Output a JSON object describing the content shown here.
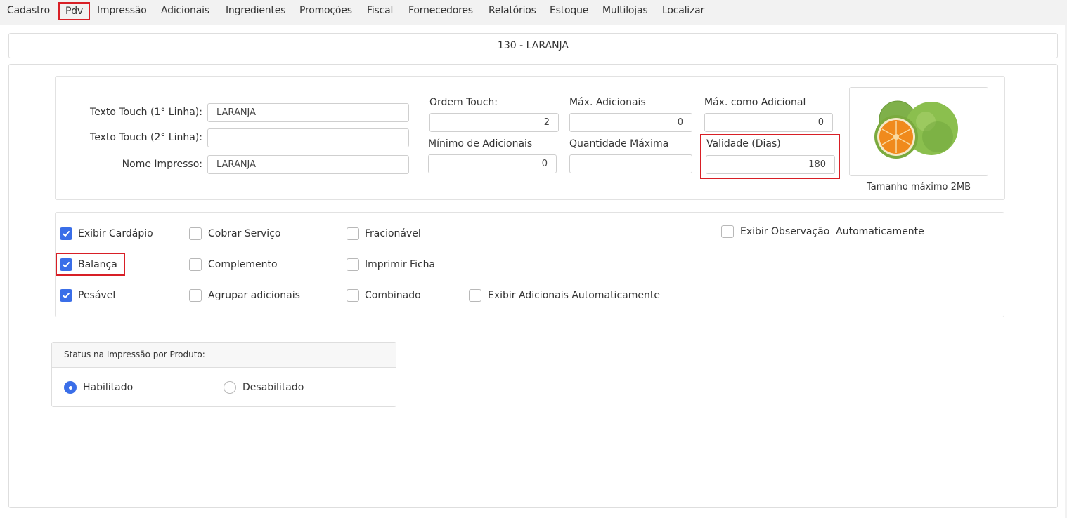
{
  "nav": {
    "tabs": [
      "Cadastro",
      "Pdv",
      "Impressão",
      "Adicionais",
      "Ingredientes",
      "Promoções",
      "Fiscal",
      "Fornecedores",
      "Relatórios",
      "Estoque",
      "Multilojas",
      "Localizar"
    ],
    "active": "Pdv"
  },
  "product": {
    "header": "130 - LARANJA"
  },
  "touch": {
    "line1_label": "Texto Touch (1° Linha):",
    "line1_value": "LARANJA",
    "line2_label": "Texto Touch (2° Linha):",
    "line2_value": "",
    "print_name_label": "Nome Impresso:",
    "print_name_value": "LARANJA"
  },
  "fields": {
    "ordem_touch_label": "Ordem Touch:",
    "ordem_touch_value": "2",
    "max_adicionais_label": "Máx. Adicionais",
    "max_adicionais_value": "0",
    "max_como_adicional_label": "Máx. como Adicional",
    "max_como_adicional_value": "0",
    "min_adicionais_label": "Mínimo de Adicionais",
    "min_adicionais_value": "0",
    "qtd_maxima_label": "Quantidade Máxima",
    "qtd_maxima_value": "",
    "validade_label": "Validade (Dias)",
    "validade_value": "180"
  },
  "image": {
    "caption": "Tamanho máximo 2MB",
    "icon": "orange-fruit-photo"
  },
  "options": {
    "exibir_cardapio": {
      "label": "Exibir Cardápio",
      "checked": true
    },
    "cobrar_servico": {
      "label": "Cobrar Serviço",
      "checked": false
    },
    "fracionavel": {
      "label": "Fracionável",
      "checked": false
    },
    "exibir_observacao": {
      "label": "Exibir Observação  Automaticamente",
      "checked": false
    },
    "balanca": {
      "label": "Balança",
      "checked": true
    },
    "complemento": {
      "label": "Complemento",
      "checked": false
    },
    "imprimir_ficha": {
      "label": "Imprimir Ficha",
      "checked": false
    },
    "pesavel": {
      "label": "Pesável",
      "checked": true
    },
    "agrupar_adicionais": {
      "label": "Agrupar adicionais",
      "checked": false
    },
    "combinado": {
      "label": "Combinado",
      "checked": false
    },
    "exibir_adicionais": {
      "label": "Exibir Adicionais Automaticamente",
      "checked": false
    }
  },
  "status": {
    "title": "Status na Impressão por Produto:",
    "habilitado_label": "Habilitado",
    "desabilitado_label": "Desabilitado",
    "selected": "Habilitado"
  },
  "colors": {
    "accent": "#3a6ee8",
    "highlight": "#d81f26",
    "nav_bg": "#f2f2f2"
  }
}
